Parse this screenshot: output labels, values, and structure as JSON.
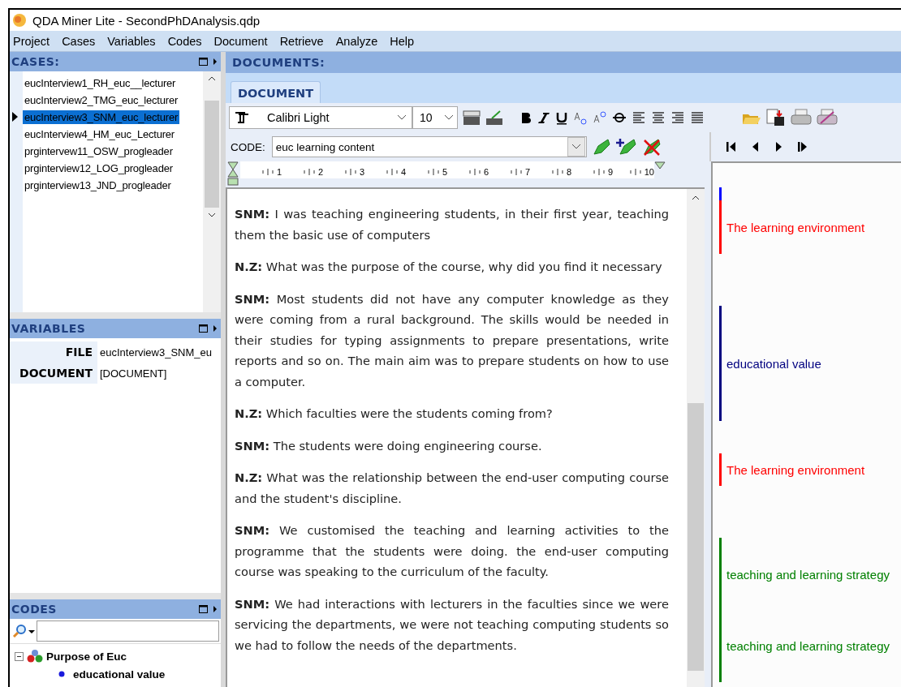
{
  "window": {
    "title": "QDA Miner Lite - SecondPhDAnalysis.qdp"
  },
  "menu": [
    "Project",
    "Cases",
    "Variables",
    "Codes",
    "Document",
    "Retrieve",
    "Analyze",
    "Help"
  ],
  "cases": {
    "title": "CASES:",
    "items": [
      {
        "label": "eucInterview1_RH_euc__lecturer",
        "selected": false
      },
      {
        "label": "eucInterview2_TMG_euc_lecturer",
        "selected": false
      },
      {
        "label": "eucInterview3_SNM_euc_lecturer",
        "selected": true
      },
      {
        "label": "eucInterview4_HM_euc_Lecturer",
        "selected": false
      },
      {
        "label": "prgintervew11_OSW_progleader",
        "selected": false
      },
      {
        "label": "prginterview12_LOG_progleader",
        "selected": false
      },
      {
        "label": "prginterview13_JND_progleader",
        "selected": false
      }
    ]
  },
  "variables": {
    "title": "VARIABLES",
    "rows": [
      {
        "name": "FILE",
        "value": "eucInterview3_SNM_eu"
      },
      {
        "name": "DOCUMENT",
        "value": "[DOCUMENT]"
      }
    ]
  },
  "codes": {
    "title": "CODES",
    "tree": [
      {
        "label": "Purpose of Euc",
        "expanded": true,
        "children": [
          {
            "label": "educational value"
          }
        ]
      }
    ]
  },
  "documents": {
    "title": "DOCUMENTS:",
    "tabs": [
      {
        "label": "DOCUMENT",
        "selected": true
      }
    ],
    "font": "Calibri Light",
    "size": "10",
    "code_label": "CODE:",
    "code": "euc learning content",
    "ruler": [
      "1",
      "2",
      "3",
      "4",
      "5",
      "6",
      "7",
      "8",
      "9",
      "10"
    ],
    "paragraphs": [
      "**SNM:** I was teaching engineering students, in their first year, teaching them the basic use of computers",
      "**N.Z:** What was the purpose of the course, why did you find it necessary",
      "**SNM:** Most students did not have any computer knowledge as they were coming from a rural background. The skills would be needed in their studies for typing assignments to prepare presentations, write reports and so on. The main aim was to prepare students on how to use a computer.",
      "**N.Z:** Which faculties were the students coming from?",
      "**SNM:** The students were doing engineering course.",
      "**N.Z:** What was the relationship between the end-user computing course and the student's discipline.",
      "**SNM:** We customised the teaching and learning activities to the programme that the students were doing. the end-user computing course was speaking to the curriculum of the faculty.",
      "**SNM:** We had interactions with lecturers in the faculties since we were servicing the departments, we were not teaching computing students so we had to follow the needs of the departments."
    ],
    "margin": [
      {
        "color": "#0000ff"
      },
      {
        "label": "The learning environment",
        "color": "#ff0000"
      },
      {
        "label": "educational value",
        "color": "#000080"
      },
      {
        "label": "The learning environment",
        "color": "#ff0000"
      },
      {
        "label": "teaching and learning strategy",
        "color": "#008000"
      },
      {
        "label": "teaching and learning strategy",
        "color": "#008000"
      }
    ]
  }
}
